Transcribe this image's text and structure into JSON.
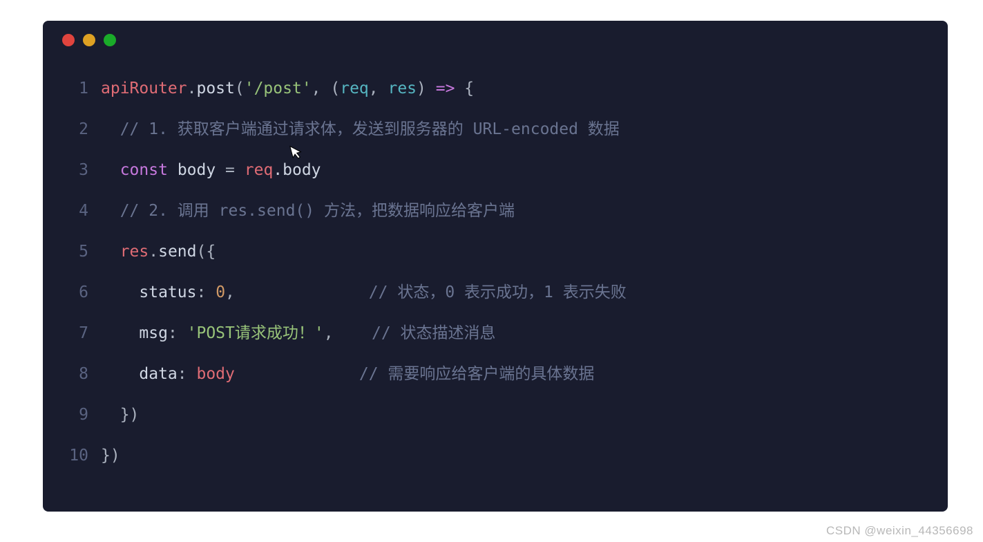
{
  "window": {
    "traffic_lights": [
      "red",
      "yellow",
      "green"
    ]
  },
  "code": {
    "lines": [
      {
        "num": "1",
        "indent": "",
        "tokens": [
          {
            "t": "apiRouter",
            "c": "tok-var"
          },
          {
            "t": ".",
            "c": "tok-punct"
          },
          {
            "t": "post",
            "c": "tok-method-call"
          },
          {
            "t": "(",
            "c": "tok-punct"
          },
          {
            "t": "'/post'",
            "c": "tok-string"
          },
          {
            "t": ", (",
            "c": "tok-punct"
          },
          {
            "t": "req",
            "c": "tok-param"
          },
          {
            "t": ", ",
            "c": "tok-punct"
          },
          {
            "t": "res",
            "c": "tok-param"
          },
          {
            "t": ") ",
            "c": "tok-punct"
          },
          {
            "t": "=>",
            "c": "tok-keyword"
          },
          {
            "t": " {",
            "c": "tok-punct"
          }
        ]
      },
      {
        "num": "2",
        "indent": "  ",
        "tokens": [
          {
            "t": "// 1. 获取客户端通过请求体，发送到服务器的 URL-encoded 数据",
            "c": "tok-comment"
          }
        ]
      },
      {
        "num": "3",
        "indent": "  ",
        "tokens": [
          {
            "t": "const",
            "c": "tok-keyword"
          },
          {
            "t": " ",
            "c": "tok-punct"
          },
          {
            "t": "body",
            "c": "tok-ident"
          },
          {
            "t": " = ",
            "c": "tok-punct"
          },
          {
            "t": "req",
            "c": "tok-req"
          },
          {
            "t": ".body",
            "c": "tok-ident"
          }
        ]
      },
      {
        "num": "4",
        "indent": "  ",
        "tokens": [
          {
            "t": "// 2. 调用 res.send() 方法，把数据响应给客户端",
            "c": "tok-comment"
          }
        ]
      },
      {
        "num": "5",
        "indent": "  ",
        "tokens": [
          {
            "t": "res",
            "c": "tok-res"
          },
          {
            "t": ".",
            "c": "tok-punct"
          },
          {
            "t": "send",
            "c": "tok-ident"
          },
          {
            "t": "({",
            "c": "tok-punct"
          }
        ]
      },
      {
        "num": "6",
        "indent": "    ",
        "tokens": [
          {
            "t": "status",
            "c": "tok-prop"
          },
          {
            "t": ": ",
            "c": "tok-punct"
          },
          {
            "t": "0",
            "c": "tok-number"
          },
          {
            "t": ",",
            "c": "tok-punct"
          },
          {
            "t": "              ",
            "c": "tok-punct"
          },
          {
            "t": "// 状态，0 表示成功，1 表示失败",
            "c": "tok-comment"
          }
        ]
      },
      {
        "num": "7",
        "indent": "    ",
        "tokens": [
          {
            "t": "msg",
            "c": "tok-prop"
          },
          {
            "t": ": ",
            "c": "tok-punct"
          },
          {
            "t": "'POST请求成功！'",
            "c": "tok-string"
          },
          {
            "t": ",",
            "c": "tok-punct"
          },
          {
            "t": "    ",
            "c": "tok-punct"
          },
          {
            "t": "// 状态描述消息",
            "c": "tok-comment"
          }
        ]
      },
      {
        "num": "8",
        "indent": "    ",
        "tokens": [
          {
            "t": "data",
            "c": "tok-prop"
          },
          {
            "t": ": ",
            "c": "tok-punct"
          },
          {
            "t": "body",
            "c": "tok-body"
          },
          {
            "t": "             ",
            "c": "tok-punct"
          },
          {
            "t": "// 需要响应给客户端的具体数据",
            "c": "tok-comment"
          }
        ]
      },
      {
        "num": "9",
        "indent": "  ",
        "tokens": [
          {
            "t": "})",
            "c": "tok-punct"
          }
        ]
      },
      {
        "num": "10",
        "indent": "",
        "tokens": [
          {
            "t": "})",
            "c": "tok-punct"
          }
        ]
      }
    ]
  },
  "watermark": "CSDN @weixin_44356698"
}
